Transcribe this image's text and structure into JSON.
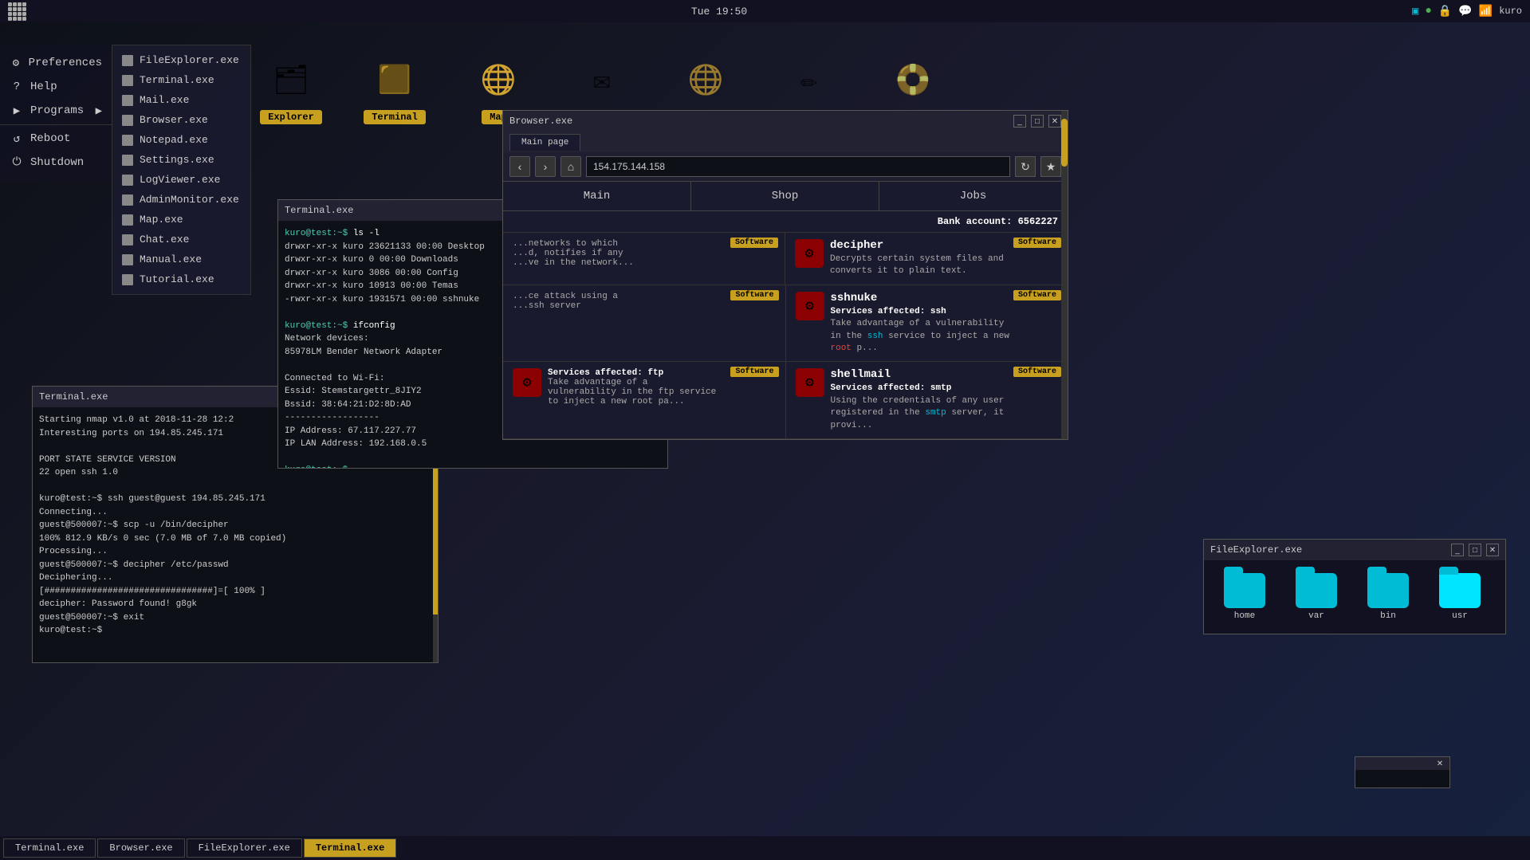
{
  "topbar": {
    "datetime": "Tue 19:50",
    "user": "kuro"
  },
  "left_menu": {
    "items": [
      {
        "id": "preferences",
        "label": "Preferences",
        "icon": "⚙"
      },
      {
        "id": "help",
        "label": "Help",
        "icon": "?"
      },
      {
        "id": "programs",
        "label": "Programs",
        "icon": "▶",
        "has_arrow": true
      },
      {
        "id": "reboot",
        "label": "Reboot",
        "icon": "↺"
      },
      {
        "id": "shutdown",
        "label": "Shutdown",
        "icon": "⏻"
      }
    ]
  },
  "app_submenu": {
    "apps": [
      "FileExplorer.exe",
      "Terminal.exe",
      "Mail.exe",
      "Browser.exe",
      "Notepad.exe",
      "Settings.exe",
      "LogViewer.exe",
      "AdminMonitor.exe",
      "Map.exe",
      "Chat.exe",
      "Manual.exe",
      "Tutorial.exe"
    ]
  },
  "desktop_icons": [
    {
      "id": "explorer",
      "label": "Explorer",
      "icon": "🗂"
    },
    {
      "id": "terminal",
      "label": "Terminal",
      "icon": "⬛"
    },
    {
      "id": "map",
      "label": "Map",
      "icon": "🌐"
    }
  ],
  "terminal_mid": {
    "title": "Terminal.exe",
    "content": "kuro@test:~$ ls -l\ndrwxr-xr-x  kuro  23621133  00:00  Desktop\ndrwxr-xr-x  kuro  0         00:00  Downloads\ndrwxr-xr-x  kuro  3086      00:00  Config\ndrwxr-xr-x  kuro  10913     00:00  Temas\n-rwxr-xr-x  kuro  1931571   00:00  sshnuke\n\nkuro@test:~$ ifconfig\nNetwork devices:\n85978LM Bender Network Adapter\n\nConnected to Wi-Fi:\nEssid: Stemstargettr_8JIY2\nBssid: 38:64:21:D2:8D:AD\n------------------\nIP Address: 67.117.227.77\nIP LAN Address: 192.168.0.5\n\nkuro@test:~$"
  },
  "terminal_bl": {
    "title": "Terminal.exe",
    "content": "Starting nmap v1.0 at 2018-11-28 12:2\nInteresting ports on 194.85.245.171\n\nPORT   STATE  SERVICE  VERSION\n22     open   ssh      1.0\n\nkuro@test:~$ ssh guest@guest 194.85.245.171\nConnecting...\nguest@500007:~$ scp -u /bin/decipher\n100%    812.9 KB/s      0 sec (7.0 MB of 7.0 MB copied)\nProcessing...\nguest@500007:~$ decipher /etc/passwd\nDeciphering...\n[################################]=[ 100% ]\ndecipher: Password found! g8gk\nguest@500007:~$ exit\nkuro@test:~$"
  },
  "browser": {
    "title": "Browser.exe",
    "tab": "Main page",
    "url": "154.175.144.158",
    "nav_items": [
      "Main",
      "Shop",
      "Jobs"
    ],
    "bank_label": "Bank account:",
    "bank_value": "6562227",
    "software_items": [
      {
        "id": "decipher",
        "title": "decipher",
        "badge": "Software",
        "icon": "⚙",
        "desc": "Decrypts certain system files and converts it to plain text."
      },
      {
        "id": "sshnuke",
        "title": "sshnuke",
        "badge": "Software",
        "icon": "⚙",
        "desc": "Services affected: ssh\nTake advantage of a vulnerability in the ssh service to inject a new root p..."
      },
      {
        "id": "shellmail",
        "title": "shellmail",
        "badge": "Software",
        "icon": "⚙",
        "desc": "Services affected: smtp\nUsing the credentials of any user registered in the smtp server, it provi..."
      }
    ],
    "left_partial": {
      "badge": "Software",
      "title_partial": "...",
      "desc1": "Services affected: ftp",
      "desc2": "Take advantage of a vulnerability in the ftp service to inject a new root pa..."
    }
  },
  "fileexp": {
    "folders": [
      "home",
      "var",
      "bin",
      "usr"
    ]
  },
  "taskbar": {
    "items": [
      {
        "label": "Terminal.exe",
        "active": false
      },
      {
        "label": "Browser.exe",
        "active": false
      },
      {
        "label": "FileExplorer.exe",
        "active": false
      },
      {
        "label": "Terminal.exe",
        "active": true
      }
    ]
  }
}
